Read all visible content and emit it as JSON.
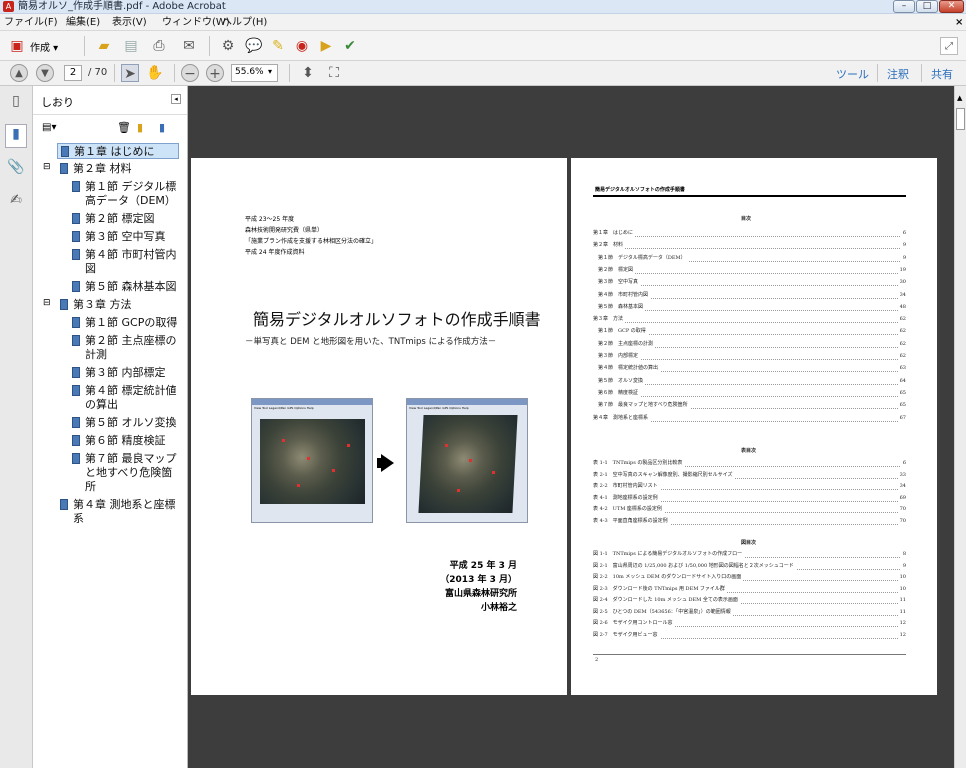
{
  "window": {
    "title": "簡易オルソ_作成手順書.pdf - Adobe Acrobat",
    "minimize": "–",
    "maximize": "□",
    "close": "✕"
  },
  "menu": [
    "ファイル(F)",
    "編集(E)",
    "表示(V)",
    "ウィンドウ(W)",
    "ヘルプ(H)"
  ],
  "menu_close": "×",
  "toolbar": {
    "create_label": "作成 ▾"
  },
  "nav": {
    "page_current": "2",
    "page_total": "/ 70",
    "zoom": "55.6%",
    "tools": "ツール",
    "comment": "注釈",
    "share": "共有"
  },
  "panel": {
    "title": "しおり"
  },
  "bookmarks": [
    {
      "lines": [
        "第１章 はじめに"
      ],
      "selected": true
    },
    {
      "lines": [
        "第２章 材料"
      ],
      "expander": "⊟"
    },
    {
      "lines": [
        "第１節 デジタル標",
        "高データ（DEM）"
      ]
    },
    {
      "lines": [
        "第２節 標定図"
      ]
    },
    {
      "lines": [
        "第３節 空中写真"
      ]
    },
    {
      "lines": [
        "第４節 市町村管内",
        "図"
      ]
    },
    {
      "lines": [
        "第５節 森林基本図"
      ]
    },
    {
      "lines": [
        "第３章 方法"
      ],
      "expander": "⊟"
    },
    {
      "lines": [
        "第１節 GCPの取得"
      ]
    },
    {
      "lines": [
        "第２節 主点座標の",
        "計測"
      ]
    },
    {
      "lines": [
        "第３節 内部標定"
      ]
    },
    {
      "lines": [
        "第４節 標定統計値",
        "の算出"
      ]
    },
    {
      "lines": [
        "第５節 オルソ変換"
      ]
    },
    {
      "lines": [
        "第６節 精度検証"
      ]
    },
    {
      "lines": [
        "第７節 最良マップ",
        "と地すべり危険箇",
        "所"
      ]
    },
    {
      "lines": [
        "第４章 測地系と座標",
        "系"
      ]
    }
  ],
  "left_page": {
    "header_lines": [
      "平成 23～25 年度",
      "森林技術開発研究費（県単）",
      "「施業プラン作成を支援する林相区分法の確立」",
      "平成 24 年度作成資料"
    ],
    "title": "簡易デジタルオルソフォトの作成手順書",
    "subtitle": "－単写真と DEM と地形図を用いた、TNTmips による作成方法－",
    "date": "平成 25 年 3 月",
    "date2": "（2013 年 3 月）",
    "org": "富山県森林研究所",
    "author": "小林裕之",
    "screenshot_menu": "View  Tool  Legend/Pan  GPS  Options    Help"
  },
  "right_page": {
    "running_header": "簡易デジタルオルソフォトの作成手順書",
    "toc_title": "目次",
    "toc": [
      {
        "t": "第１章　はじめに",
        "p": "6"
      },
      {
        "t": "第２章　材料",
        "p": "9"
      },
      {
        "t": "　第１節　デジタル標高データ（DEM）",
        "p": "9"
      },
      {
        "t": "　第２節　標定図",
        "p": "19"
      },
      {
        "t": "　第３節　空中写真",
        "p": "30"
      },
      {
        "t": "　第４節　市町村管内図",
        "p": "34"
      },
      {
        "t": "　第５節　森林基本図",
        "p": "48"
      },
      {
        "t": "第３章　方法",
        "p": "62"
      },
      {
        "t": "　第１節　GCP の取得",
        "p": "62"
      },
      {
        "t": "　第２節　主点座標の計測",
        "p": "62"
      },
      {
        "t": "　第３節　内部標定",
        "p": "62"
      },
      {
        "t": "　第４節　標定統計値の算出",
        "p": "63"
      },
      {
        "t": "　第５節　オルソ変換",
        "p": "64"
      },
      {
        "t": "　第６節　精度検証",
        "p": "65"
      },
      {
        "t": "　第７節　最良マップと地すべり危険箇所",
        "p": "65"
      },
      {
        "t": "第４章　測地系と座標系",
        "p": "67"
      }
    ],
    "table_title": "表目次",
    "tables": [
      {
        "t": "表 1-1　TNTmips の製品区分別比較表",
        "p": "6"
      },
      {
        "t": "表 2-1　空中写真のスキャン解像度別、撮影縮尺別セルサイズ",
        "p": "33"
      },
      {
        "t": "表 2-2　市町村管内図リスト",
        "p": "34"
      },
      {
        "t": "表 4-1　測地座標系の設定例",
        "p": "69"
      },
      {
        "t": "表 4-2　UTM 座標系の設定例",
        "p": "70"
      },
      {
        "t": "表 4-3　平面直角座標系の設定例",
        "p": "70"
      }
    ],
    "fig_title": "図目次",
    "figs": [
      {
        "t": "図 1-1　TNTmips による簡易デジタルオルソフォトの作成フロー",
        "p": "8"
      },
      {
        "t": "図 2-1　富山県周辺の 1/25,000 および 1/50,000 地形図の図幅名と２次メッシュコード",
        "p": "9"
      },
      {
        "t": "図 2-2　10m メッシュ DEM のダウンロードサイト入り口の画面",
        "p": "10"
      },
      {
        "t": "図 2-3　ダウンロード後の TNTmips 用 DEM ファイル群",
        "p": "10"
      },
      {
        "t": "図 2-4　ダウンロードした 10m メッシュ DEM 全ての表示画面",
        "p": "11"
      },
      {
        "t": "図 2-5　ひとつの DEM（543656：「中宮温泉」）の範囲情報",
        "p": "11"
      },
      {
        "t": "図 2-6　モザイク用コントロール窓",
        "p": "12"
      },
      {
        "t": "図 2-7　モザイク用ビュー窓",
        "p": "12"
      }
    ],
    "page_number": "2"
  },
  "colors": {
    "doc_bg": "#3d3d3d",
    "selected": "#cde3f8",
    "accent": "#3a6fb5",
    "link": "#2a6ebd"
  }
}
